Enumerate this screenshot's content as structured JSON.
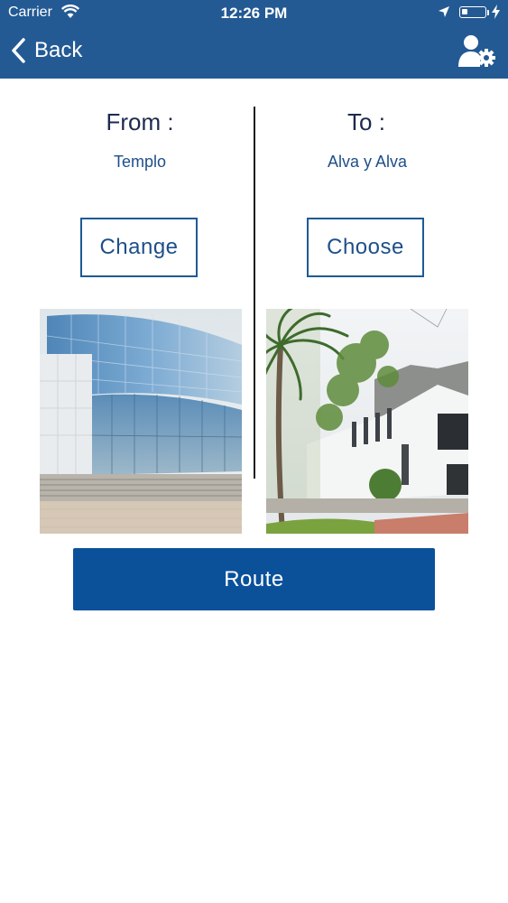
{
  "status_bar": {
    "carrier": "Carrier",
    "time": "12:26 PM"
  },
  "nav": {
    "back_label": "Back",
    "back_icon": "chevron-left-icon",
    "settings_icon": "user-settings-icon"
  },
  "from": {
    "title": "From :",
    "place": "Templo",
    "button_label": "Change"
  },
  "to": {
    "title": "To :",
    "place": "Alva y Alva",
    "button_label": "Choose"
  },
  "route_label": "Route",
  "colors": {
    "header": "#245a93",
    "accent": "#0a519a",
    "text_dark": "#1d2a4d",
    "text_link": "#1e4f8a"
  }
}
